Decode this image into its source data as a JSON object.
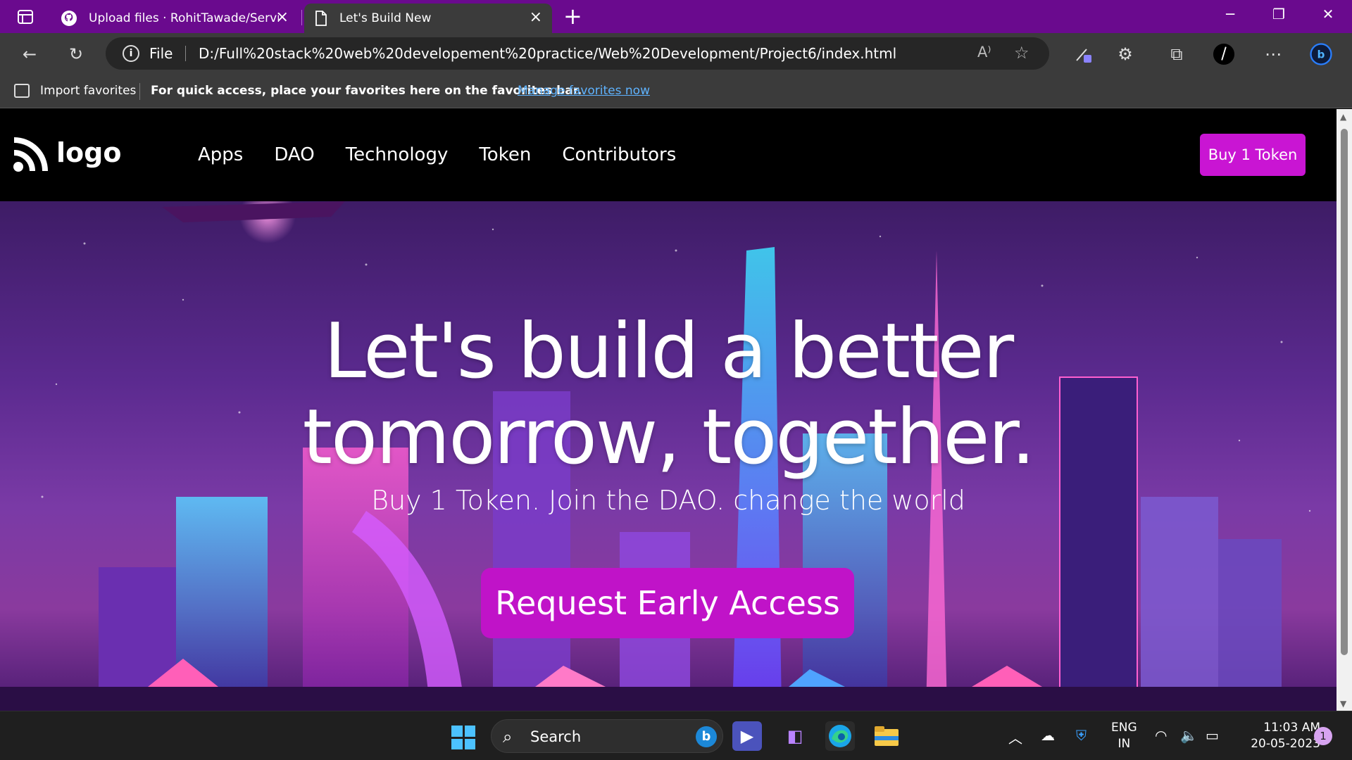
{
  "browser": {
    "tabs": [
      {
        "title": "Upload files · RohitTawade/Servic",
        "icon": "github-icon",
        "active": false
      },
      {
        "title": "Let's Build New",
        "icon": "page-icon",
        "active": true
      }
    ],
    "new_tab_label": "+",
    "address": {
      "scheme_label": "File",
      "url": "D:/Full%20stack%20web%20developement%20practice/Web%20Development/Project6/index.html"
    },
    "favorites_bar": {
      "import_label": "Import favorites",
      "hint": "For quick access, place your favorites here on the favorites bar.",
      "manage_link": "Manage favorites now"
    }
  },
  "site": {
    "logo_text": "logo",
    "nav": [
      "Apps",
      "DAO",
      "Technology",
      "Token",
      "Contributors"
    ],
    "buy_button": "Buy 1 Token",
    "hero": {
      "title_line1": "Let's build a better",
      "title_line2": "tomorrow, together.",
      "subtitle": "Buy 1 Token. Join the DAO. change the world",
      "cta": "Request Early Access"
    },
    "colors": {
      "accent": "#c915d3",
      "nav_bg": "#000000"
    }
  },
  "taskbar": {
    "search_label": "Search",
    "language": {
      "line1": "ENG",
      "line2": "IN"
    },
    "time": "11:03 AM",
    "date": "20-05-2023",
    "notification_count": "1"
  }
}
